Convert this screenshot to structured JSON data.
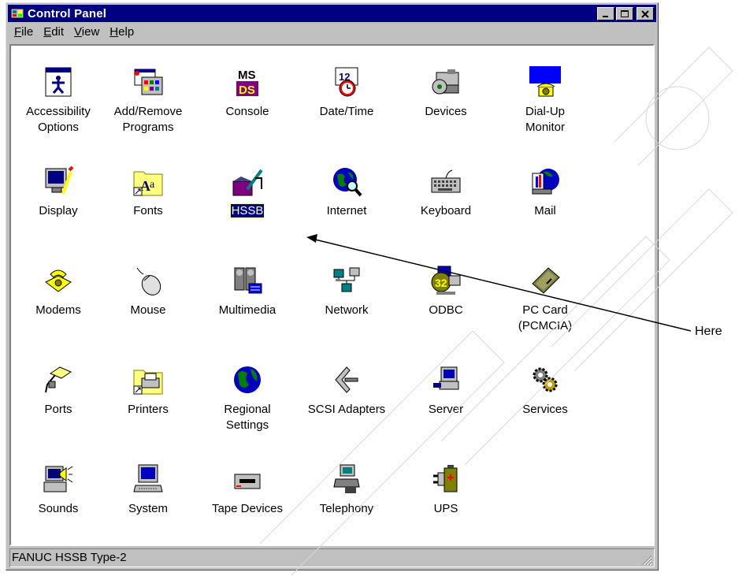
{
  "window": {
    "title": "Control Panel"
  },
  "menu": [
    {
      "label": "File",
      "key": "F",
      "rest": "ile"
    },
    {
      "label": "Edit",
      "key": "E",
      "rest": "dit"
    },
    {
      "label": "View",
      "key": "V",
      "rest": "iew"
    },
    {
      "label": "Help",
      "key": "H",
      "rest": "elp"
    }
  ],
  "icons": [
    {
      "label": "Accessibility\nOptions",
      "icon": "accessibility-icon"
    },
    {
      "label": "Add/Remove\nPrograms",
      "icon": "add-remove-programs-icon"
    },
    {
      "label": "Console",
      "icon": "console-icon"
    },
    {
      "label": "Date/Time",
      "icon": "date-time-icon"
    },
    {
      "label": "Devices",
      "icon": "devices-icon"
    },
    {
      "label": "Dial-Up\nMonitor",
      "icon": "dial-up-monitor-icon"
    },
    {
      "label": "Display",
      "icon": "display-icon"
    },
    {
      "label": "Fonts",
      "icon": "fonts-icon"
    },
    {
      "label": "HSSB",
      "icon": "hssb-icon",
      "selected": true
    },
    {
      "label": "Internet",
      "icon": "internet-icon"
    },
    {
      "label": "Keyboard",
      "icon": "keyboard-icon"
    },
    {
      "label": "Mail",
      "icon": "mail-icon"
    },
    {
      "label": "Modems",
      "icon": "modems-icon"
    },
    {
      "label": "Mouse",
      "icon": "mouse-icon"
    },
    {
      "label": "Multimedia",
      "icon": "multimedia-icon"
    },
    {
      "label": "Network",
      "icon": "network-icon"
    },
    {
      "label": "ODBC",
      "icon": "odbc-icon"
    },
    {
      "label": "PC Card\n(PCMCIA)",
      "icon": "pc-card-icon"
    },
    {
      "label": "Ports",
      "icon": "ports-icon"
    },
    {
      "label": "Printers",
      "icon": "printers-icon"
    },
    {
      "label": "Regional\nSettings",
      "icon": "regional-settings-icon"
    },
    {
      "label": "SCSI Adapters",
      "icon": "scsi-adapters-icon"
    },
    {
      "label": "Server",
      "icon": "server-icon"
    },
    {
      "label": "Services",
      "icon": "services-icon"
    },
    {
      "label": "Sounds",
      "icon": "sounds-icon"
    },
    {
      "label": "System",
      "icon": "system-icon"
    },
    {
      "label": "Tape Devices",
      "icon": "tape-devices-icon"
    },
    {
      "label": "Telephony",
      "icon": "telephony-icon"
    },
    {
      "label": "UPS",
      "icon": "ups-icon"
    }
  ],
  "statusbar": {
    "text": "FANUC HSSB Type-2"
  },
  "annotation": {
    "label": "Here"
  },
  "colors": {
    "titlebar": "#000080",
    "selection": "#000080",
    "face": "#c0c0c0"
  }
}
